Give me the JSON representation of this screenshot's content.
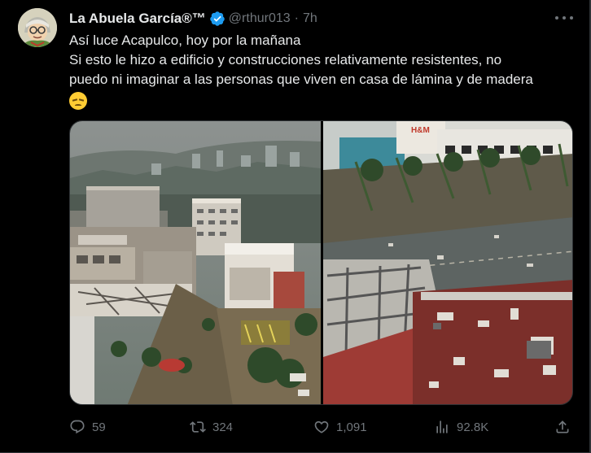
{
  "tweet": {
    "author_name": "La Abuela García®™",
    "handle": "@rthur013",
    "separator": "·",
    "time": "7h",
    "text_lines": [
      "Así luce Acapulco, hoy por la mañana",
      "Si esto le hizo a edificio y construcciones relativamente resistentes, no",
      "puedo ni imaginar a las personas que viven en casa de lámina y de madera"
    ],
    "emoji": "disappointed-face-emoji"
  },
  "media": {
    "left_photo_icon": "hurricane-damaged-city-photo",
    "right_photo_icon": "aerial-damaged-street-photo",
    "sign_text": "H&M"
  },
  "actions": {
    "replies": "59",
    "reposts": "324",
    "likes": "1,091",
    "views": "92.8K"
  },
  "colors": {
    "background": "#000000",
    "text": "#e7e9ea",
    "muted": "#71767b",
    "verified": "#1d9bf0",
    "border": "#2f3336"
  }
}
